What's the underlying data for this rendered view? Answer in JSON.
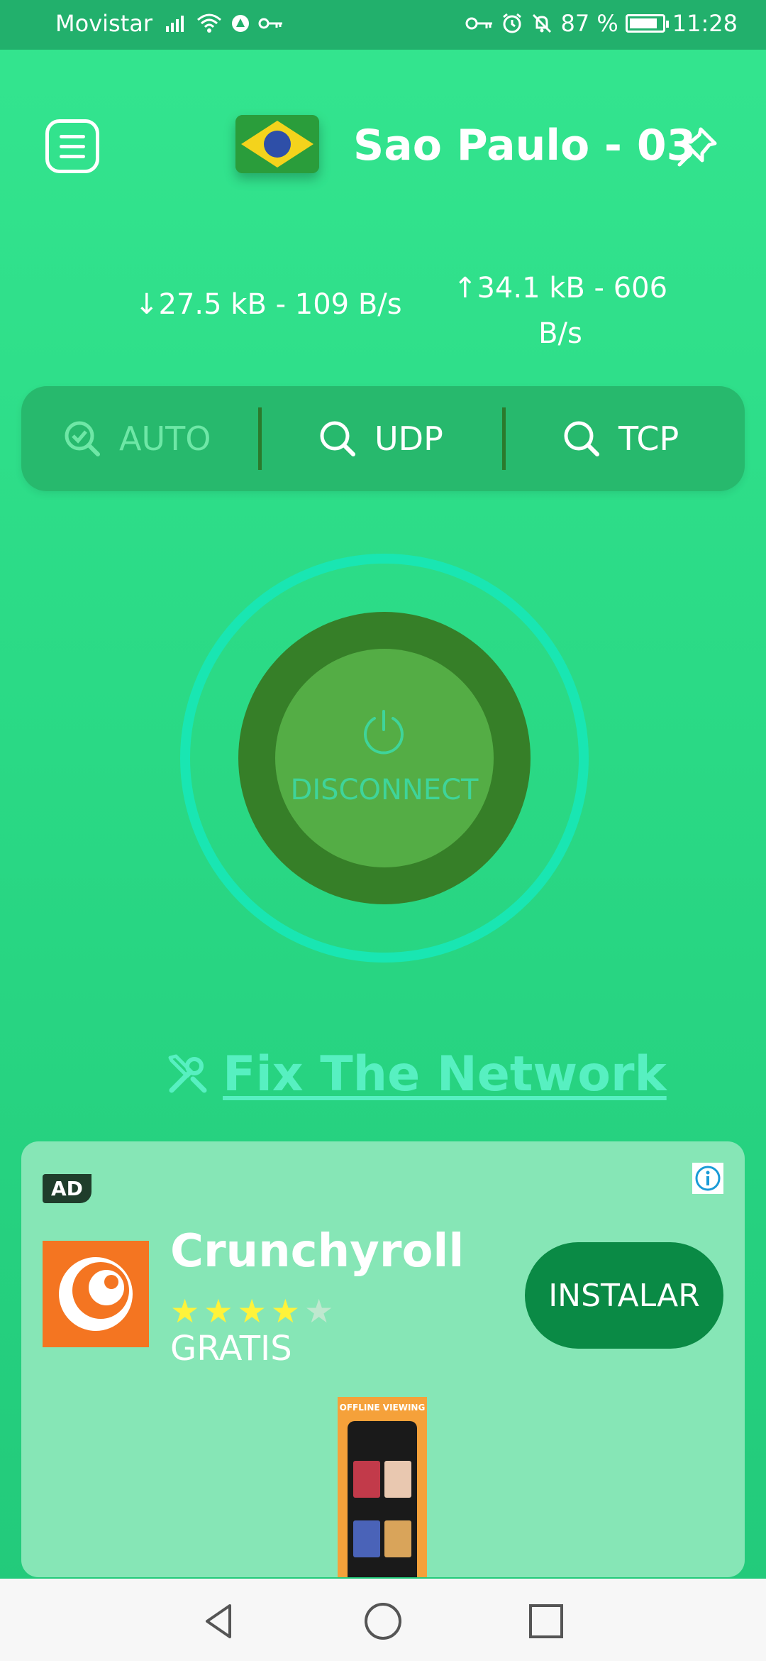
{
  "status_bar": {
    "carrier": "Movistar",
    "battery": "87 %",
    "battery_level": 0.87,
    "time": "11:28"
  },
  "header": {
    "server_name": "Sao Paulo - 03",
    "flag": "brazil-flag"
  },
  "traffic": {
    "download": "↓27.5 kB - 109 B/s",
    "upload": "↑34.1 kB - 606 B/s"
  },
  "protocols": [
    {
      "label": "AUTO",
      "icon": "search-check-icon",
      "selected": true
    },
    {
      "label": "UDP",
      "icon": "search-icon",
      "selected": false
    },
    {
      "label": "TCP",
      "icon": "search-icon",
      "selected": false
    }
  ],
  "connect": {
    "label": "DISCONNECT"
  },
  "fix_network": {
    "label": "Fix The Network",
    "icon": "tools-icon"
  },
  "ad": {
    "badge": "AD",
    "app_name": "Crunchyroll",
    "rating": 4,
    "rating_max": 5,
    "price": "GRATIS",
    "install_label": "INSTALAR",
    "screenshot_caption": "OFFLINE VIEWING"
  },
  "colors": {
    "accent": "#19e6b2",
    "button_dark": "#367f28",
    "button_light": "#54ad45",
    "install": "#0a8a45",
    "brand": "#f47521"
  },
  "nav": [
    "back-icon",
    "home-icon",
    "recents-icon"
  ]
}
